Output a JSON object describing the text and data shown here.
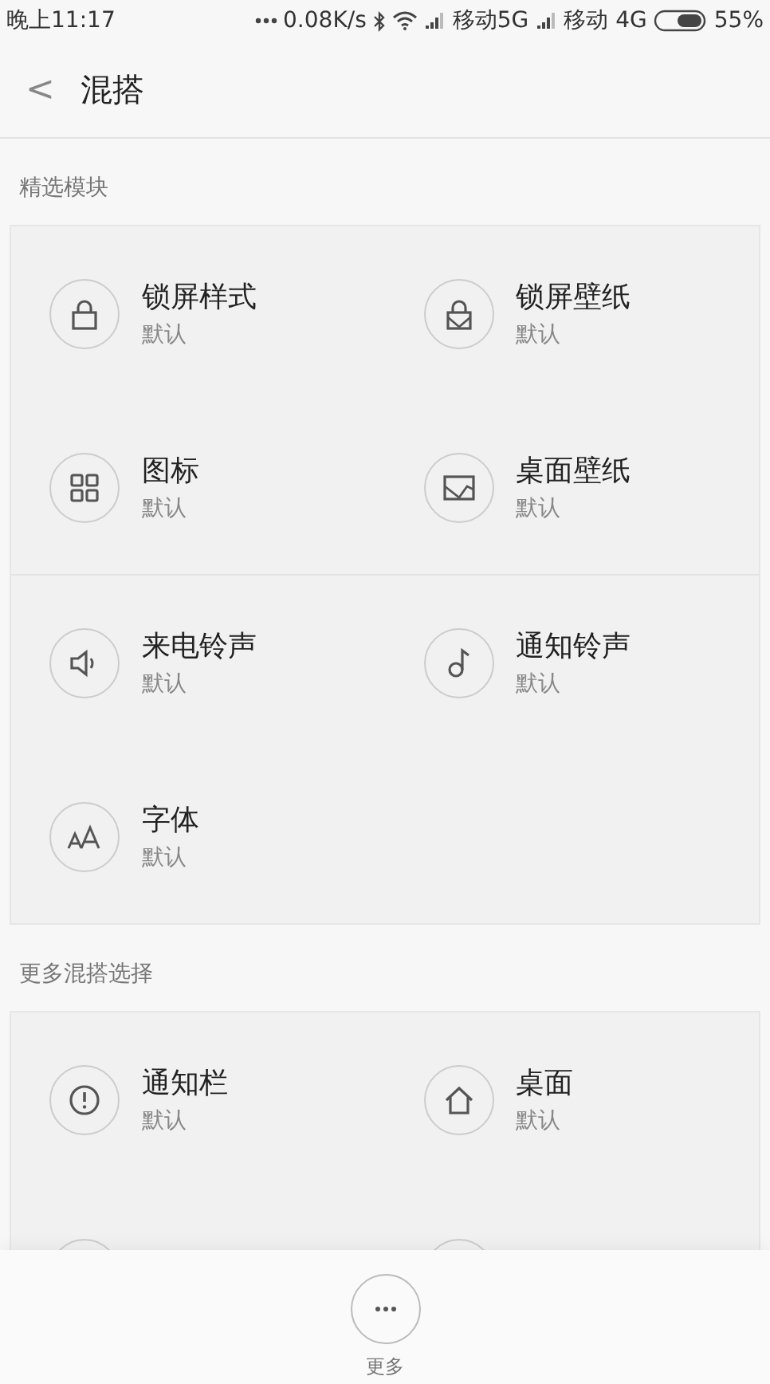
{
  "status_bar": {
    "time": "晚上11:17",
    "speed": "0.08K/s",
    "carrier_1": "移动5G",
    "carrier_2": "移动 4G",
    "battery": "55%"
  },
  "header": {
    "back": "<",
    "title": "混搭"
  },
  "sections": [
    {
      "title": "精选模块",
      "groups": [
        [
          {
            "kind": "lock",
            "name": "锁屏样式",
            "value": "默认"
          },
          {
            "kind": "lock-picture",
            "name": "锁屏壁纸",
            "value": "默认"
          },
          {
            "kind": "grid",
            "name": "图标",
            "value": "默认"
          },
          {
            "kind": "picture",
            "name": "桌面壁纸",
            "value": "默认"
          }
        ],
        [
          {
            "kind": "speaker",
            "name": "来电铃声",
            "value": "默认"
          },
          {
            "kind": "note",
            "name": "通知铃声",
            "value": "默认"
          },
          {
            "kind": "font",
            "name": "字体",
            "value": "默认"
          }
        ]
      ]
    },
    {
      "title": "更多混搭选择",
      "groups": [
        [
          {
            "kind": "alert",
            "name": "通知栏",
            "value": "默认"
          },
          {
            "kind": "home",
            "name": "桌面",
            "value": "默认"
          },
          {
            "kind": "hidden"
          },
          {
            "kind": "hidden"
          }
        ]
      ]
    }
  ],
  "bottom": {
    "label": "更多"
  }
}
